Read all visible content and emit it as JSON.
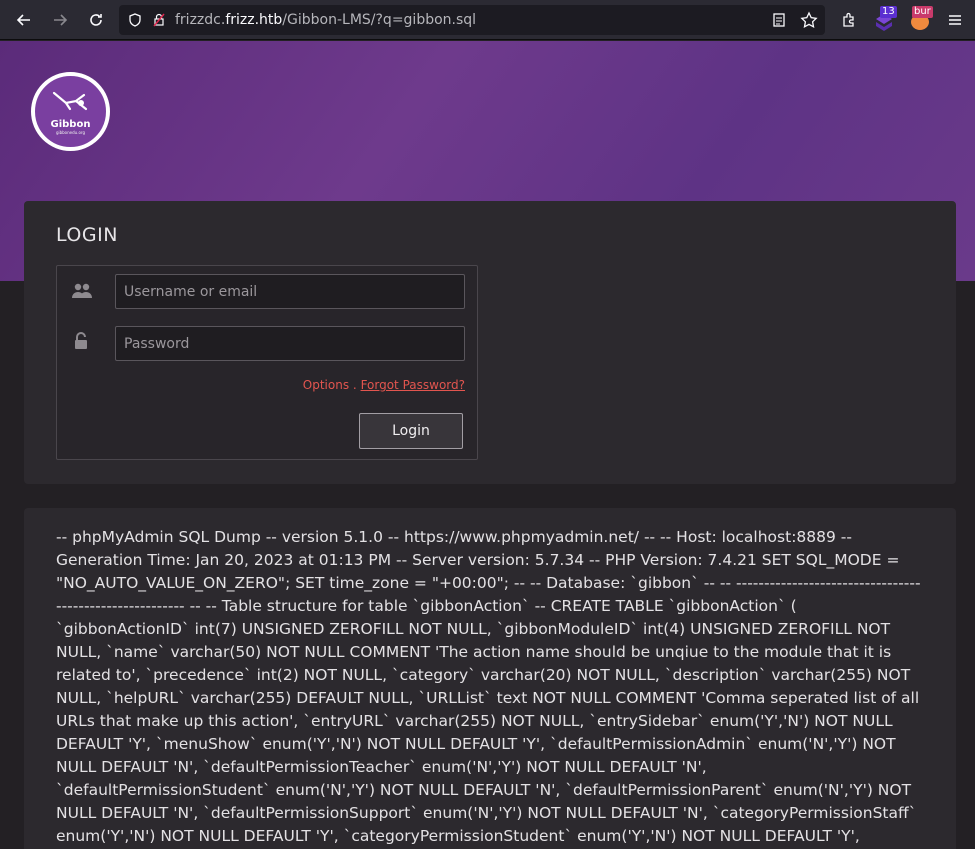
{
  "browser": {
    "url_prefix": "frizzdc.",
    "url_host": "frizz.htb",
    "url_path": "/Gibbon-LMS/?q=gibbon.sql",
    "ext_badge_count": "13",
    "ext_badge_label": "bur"
  },
  "logo": {
    "name": "Gibbon",
    "site": "gibbonedu.org"
  },
  "login": {
    "title": "LOGIN",
    "username_placeholder": "Username or email",
    "password_placeholder": "Password",
    "options_link": "Options",
    "separator": ".",
    "forgot_link": "Forgot Password?",
    "login_button": "Login"
  },
  "dump": {
    "text": "-- phpMyAdmin SQL Dump -- version 5.1.0 -- https://www.phpmyadmin.net/ -- -- Host: localhost:8889 -- Generation Time: Jan 20, 2023 at 01:13 PM -- Server version: 5.7.34 -- PHP Version: 7.4.21 SET SQL_MODE = \"NO_AUTO_VALUE_ON_ZERO\"; SET time_zone = \"+00:00\"; -- -- Database: `gibbon` -- -- -------------------------------------------------------- -- -- Table structure for table `gibbonAction` -- CREATE TABLE `gibbonAction` ( `gibbonActionID` int(7) UNSIGNED ZEROFILL NOT NULL, `gibbonModuleID` int(4) UNSIGNED ZEROFILL NOT NULL, `name` varchar(50) NOT NULL COMMENT 'The action name should be unqiue to the module that it is related to', `precedence` int(2) NOT NULL, `category` varchar(20) NOT NULL, `description` varchar(255) NOT NULL, `helpURL` varchar(255) DEFAULT NULL, `URLList` text NOT NULL COMMENT 'Comma seperated list of all URLs that make up this action', `entryURL` varchar(255) NOT NULL, `entrySidebar` enum('Y','N') NOT NULL DEFAULT 'Y', `menuShow` enum('Y','N') NOT NULL DEFAULT 'Y', `defaultPermissionAdmin` enum('N','Y') NOT NULL DEFAULT 'N', `defaultPermissionTeacher` enum('N','Y') NOT NULL DEFAULT 'N', `defaultPermissionStudent` enum('N','Y') NOT NULL DEFAULT 'N', `defaultPermissionParent` enum('N','Y') NOT NULL DEFAULT 'N', `defaultPermissionSupport` enum('N','Y') NOT NULL DEFAULT 'N', `categoryPermissionStaff` enum('Y','N') NOT NULL DEFAULT 'Y', `categoryPermissionStudent` enum('Y','N') NOT NULL DEFAULT 'Y', `categoryPermissionParent` enum('Y','N') NOT NULL DEFAULT 'Y'"
  }
}
